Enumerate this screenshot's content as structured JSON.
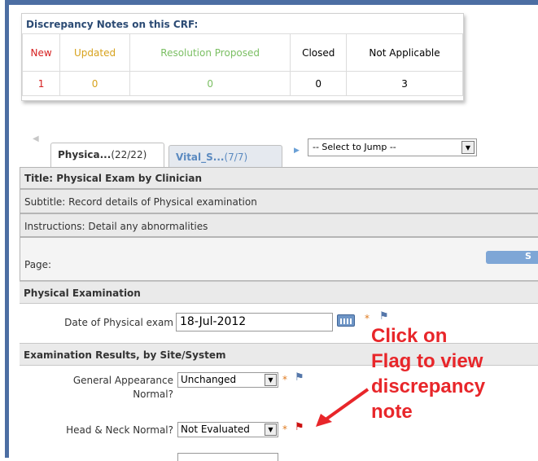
{
  "discrepancy": {
    "title": "Discrepancy Notes on this CRF:",
    "headers": [
      "New",
      "Updated",
      "Resolution Proposed",
      "Closed",
      "Not Applicable"
    ],
    "counts": [
      "1",
      "0",
      "0",
      "0",
      "3"
    ],
    "colors": {
      "new": "#d62020",
      "updated": "#d7a21d",
      "resolution": "#7bbf63",
      "closed": "#000000",
      "na": "#000000"
    }
  },
  "tabs": [
    {
      "label_bold": "Physica...",
      "count": "(22/22)",
      "active": true
    },
    {
      "label_bold": "Vital_S...",
      "count": "(7/7)",
      "active": false
    }
  ],
  "jump": {
    "selected": "-- Select to Jump --"
  },
  "form": {
    "title": "Title: Physical Exam by Clinician",
    "subtitle": "Subtitle: Record details of Physical examination",
    "instructions": "Instructions: Detail any abnormalities",
    "page_label": "Page:",
    "page_button": "S"
  },
  "sections": {
    "physical": "Physical Examination",
    "results": "Examination Results, by Site/System"
  },
  "fields": {
    "date_label": "Date of Physical exam",
    "date_value": "18-Jul-2012",
    "general_label_1": "General Appearance",
    "general_label_2": "Normal?",
    "general_value": "Unchanged",
    "head_label": "Head & Neck Normal?",
    "head_value": "Not Evaluated",
    "required_mark": "*",
    "flag_glyph": "⚑"
  },
  "annotation": {
    "line1": "Click on",
    "line2": "Flag to view",
    "line3": "discrepancy",
    "line4": "note",
    "color": "#e8262a"
  },
  "icons": {
    "calendar": "calendar-icon",
    "flag_blue": "flag-icon",
    "flag_red": "flag-icon-red",
    "dropdown": "chevron-down-icon",
    "tab_left": "arrow-left-icon",
    "tab_right": "arrow-right-icon"
  }
}
